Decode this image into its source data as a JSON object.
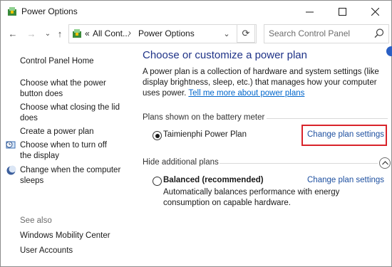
{
  "window": {
    "title": "Power Options"
  },
  "controls": {
    "minimize": "—",
    "maximize": "☐",
    "close": "✕"
  },
  "nav": {
    "back": "←",
    "forward": "→",
    "up": "↑",
    "refresh": "⟳",
    "dropdown": "⌄"
  },
  "address": {
    "overflow": "«",
    "crumbs": [
      "All Cont...",
      "Power Options"
    ],
    "separator": "›"
  },
  "search": {
    "placeholder": "Search Control Panel"
  },
  "sidebar": {
    "items": [
      {
        "label": "Control Panel Home"
      },
      {
        "label": "Choose what the power button does"
      },
      {
        "label": "Choose what closing the lid does"
      },
      {
        "label": "Create a power plan"
      },
      {
        "label": "Choose when to turn off the display",
        "icon": "display-clock-icon"
      },
      {
        "label": "Change when the computer sleeps",
        "icon": "moon-icon"
      }
    ],
    "see_also_label": "See also",
    "see_also": [
      {
        "label": "Windows Mobility Center"
      },
      {
        "label": "User Accounts"
      }
    ]
  },
  "main": {
    "heading": "Choose or customize a power plan",
    "description": "A power plan is a collection of hardware and system settings (like display brightness, sleep, etc.) that manages how your computer uses power.",
    "description_link": "Tell me more about power plans",
    "battery_section_label": "Plans shown on the battery meter",
    "hidden_section_label": "Hide additional plans",
    "plans": [
      {
        "name": "Taimienphi Power Plan",
        "selected": true,
        "change_label": "Change plan settings"
      },
      {
        "name": "Balanced (recommended)",
        "selected": false,
        "change_label": "Change plan settings",
        "description": "Automatically balances performance with energy consumption on capable hardware."
      }
    ]
  },
  "colors": {
    "heading": "#1e3287",
    "link": "#1e50a0",
    "highlight": "#d9232a"
  }
}
